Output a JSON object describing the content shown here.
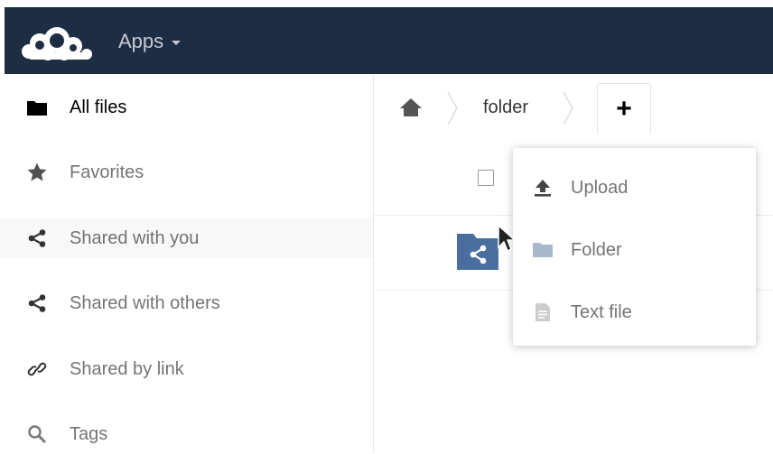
{
  "header": {
    "apps_label": "Apps"
  },
  "sidebar": {
    "items": [
      {
        "label": "All files",
        "icon": "folder-icon",
        "active": true
      },
      {
        "label": "Favorites",
        "icon": "star-icon"
      },
      {
        "label": "Shared with you",
        "icon": "share-icon"
      },
      {
        "label": "Shared with others",
        "icon": "share-icon"
      },
      {
        "label": "Shared by link",
        "icon": "link-icon"
      },
      {
        "label": "Tags",
        "icon": "search-icon"
      }
    ]
  },
  "breadcrumb": {
    "current": "folder"
  },
  "new_button": {
    "label": "+"
  },
  "new_menu": {
    "items": [
      {
        "label": "Upload",
        "icon": "upload-icon"
      },
      {
        "label": "Folder",
        "icon": "folder-icon"
      },
      {
        "label": "Text file",
        "icon": "text-file-icon"
      }
    ]
  },
  "colors": {
    "header_bg": "#1d2d44",
    "folder_shared": "#4a6f9f"
  }
}
